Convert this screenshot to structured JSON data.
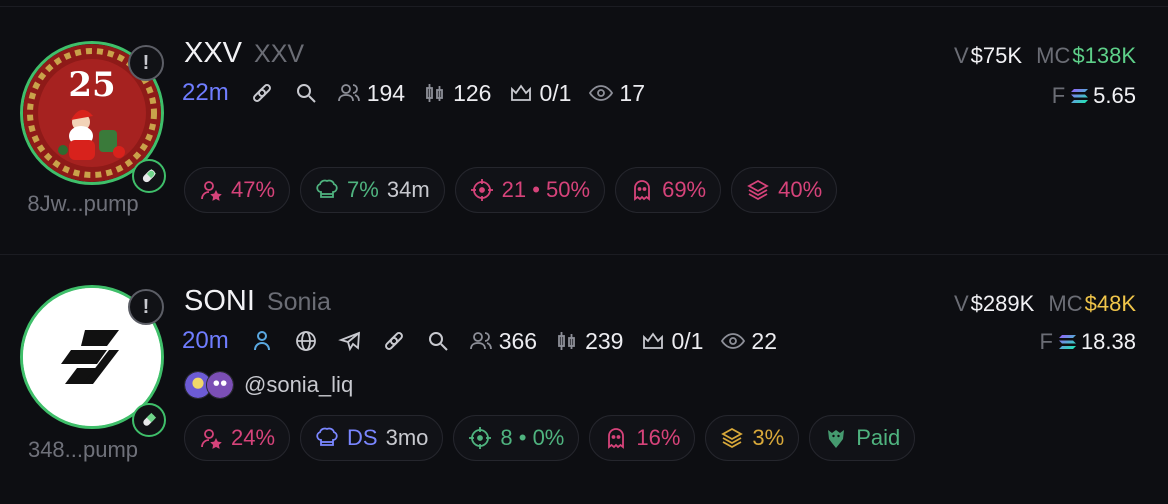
{
  "tokens": [
    {
      "symbol": "XXV",
      "name": "XXV",
      "age": "22m",
      "address": "8Jw...pump",
      "holders": "194",
      "txns": "126",
      "top": "0/1",
      "watchers": "17",
      "volume_label": "V",
      "volume": "$75K",
      "mc_label": "MC",
      "mc": "$138K",
      "fees_label": "F",
      "fees": "5.65",
      "chips": {
        "top10": "47%",
        "dev": "7%",
        "dev_time": "34m",
        "snipers": "21 • 50%",
        "insiders": "69%",
        "bundles": "40%"
      }
    },
    {
      "symbol": "SONI",
      "name": "Sonia",
      "age": "20m",
      "address": "348...pump",
      "holders": "366",
      "txns": "239",
      "top": "0/1",
      "watchers": "22",
      "volume_label": "V",
      "volume": "$289K",
      "mc_label": "MC",
      "mc": "$48K",
      "fees_label": "F",
      "fees": "18.38",
      "social_handle": "@sonia_liq",
      "chips": {
        "top10": "24%",
        "dev": "DS",
        "dev_time": "3mo",
        "snipers": "8 • 0%",
        "insiders": "16%",
        "bundles": "3%",
        "paid": "Paid"
      }
    }
  ],
  "colors": {
    "accent_blue": "#6f7dff",
    "green": "#5ed089",
    "yellow": "#f0c54a",
    "pink": "#d6437a",
    "background": "#0d0e12"
  },
  "icons": [
    "alert-icon",
    "pill-icon",
    "link-icon",
    "search-icon",
    "holders-icon",
    "candles-icon",
    "crown-icon",
    "eye-icon",
    "user-star-icon",
    "chef-hat-icon",
    "crosshair-icon",
    "ghost-icon",
    "layers-icon",
    "globe-icon",
    "telegram-icon",
    "person-icon",
    "eagle-icon",
    "solana-icon"
  ]
}
